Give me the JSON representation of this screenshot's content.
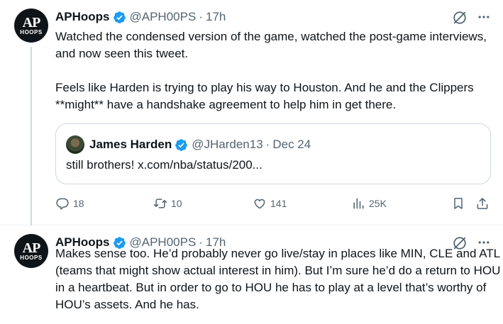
{
  "tweets": [
    {
      "author": {
        "name": "APHoops",
        "handle": "@APH00PS",
        "avatar_text_top": "AP",
        "avatar_text_bottom": "HOOPS"
      },
      "time": "17h",
      "separator": "·",
      "text": "Watched the condensed version of the game, watched the post-game interviews, and now seen this tweet.\n\nFeels like Harden is trying to play his way to Houston. And he and the Clippers **might** have a handshake agreement to help him in get there.",
      "quote": {
        "author": {
          "name": "James Harden",
          "handle": "@JHarden13"
        },
        "date": "Dec 24",
        "text": "still brothers! x.com/nba/status/200..."
      },
      "metrics": {
        "replies": "18",
        "retweets": "10",
        "likes": "141",
        "views": "25K"
      }
    },
    {
      "author": {
        "name": "APHoops",
        "handle": "@APH00PS",
        "avatar_text_top": "AP",
        "avatar_text_bottom": "HOOPS"
      },
      "time": "17h",
      "separator": "·",
      "text": "Makes sense too. He’d probably never go live/stay in places like MIN, CLE and ATL (teams that might show actual interest in him). But I’m sure he’d do a return to HOU in a heartbeat. But in order to go to HOU he has to play at a level that’s worthy of HOU’s assets. And he has."
    }
  ],
  "colors": {
    "text": "#0f1419",
    "secondary": "#536471",
    "verified": "#1d9bf0",
    "border": "#cfd9de"
  },
  "icons": [
    "verified-badge-icon",
    "grok-icon",
    "more-icon",
    "reply-icon",
    "retweet-icon",
    "like-icon",
    "views-icon",
    "bookmark-icon",
    "share-icon"
  ]
}
